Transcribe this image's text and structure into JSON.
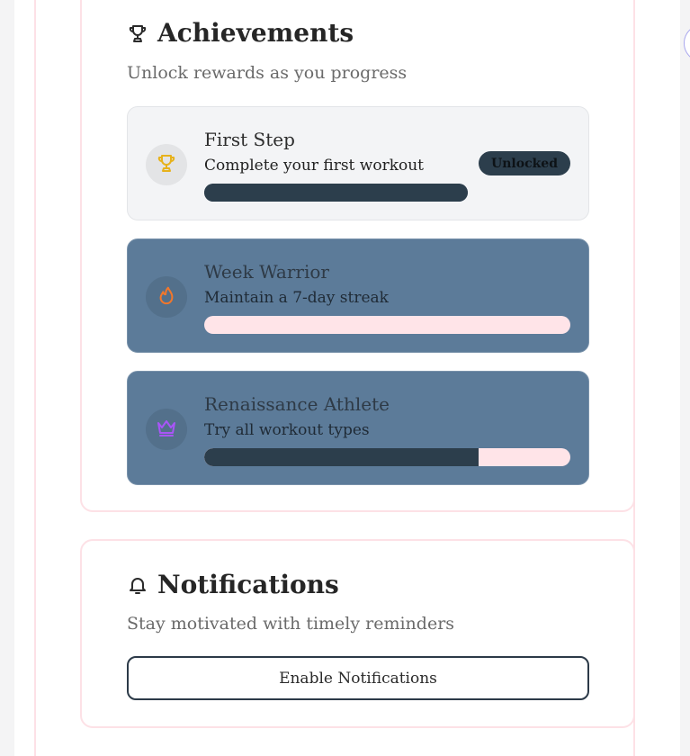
{
  "achievements": {
    "title": "Achievements",
    "subtitle": "Unlock rewards as you progress",
    "icon": "trophy-icon",
    "items": [
      {
        "title": "First Step",
        "description": "Complete your first workout",
        "status": "Unlocked",
        "progress": 1.0,
        "icon": "trophy-icon",
        "icon_color": "#e7b21c"
      },
      {
        "title": "Week Warrior",
        "description": "Maintain a 7-day streak",
        "status": "",
        "progress": 0.0,
        "icon": "flame-icon",
        "icon_color": "#f2772b"
      },
      {
        "title": "Renaissance Athlete",
        "description": "Try all workout types",
        "status": "",
        "progress": 0.75,
        "icon": "crown-icon",
        "icon_color": "#a855f7"
      }
    ]
  },
  "notifications": {
    "title": "Notifications",
    "subtitle": "Stay motivated with timely reminders",
    "icon": "bell-icon",
    "button_label": "Enable Notifications"
  },
  "colors": {
    "accent_dark": "#2c3e4c",
    "locked_card": "#5c7b99",
    "progress_track": "#ffe4e8",
    "card_border": "#fde1e6"
  }
}
